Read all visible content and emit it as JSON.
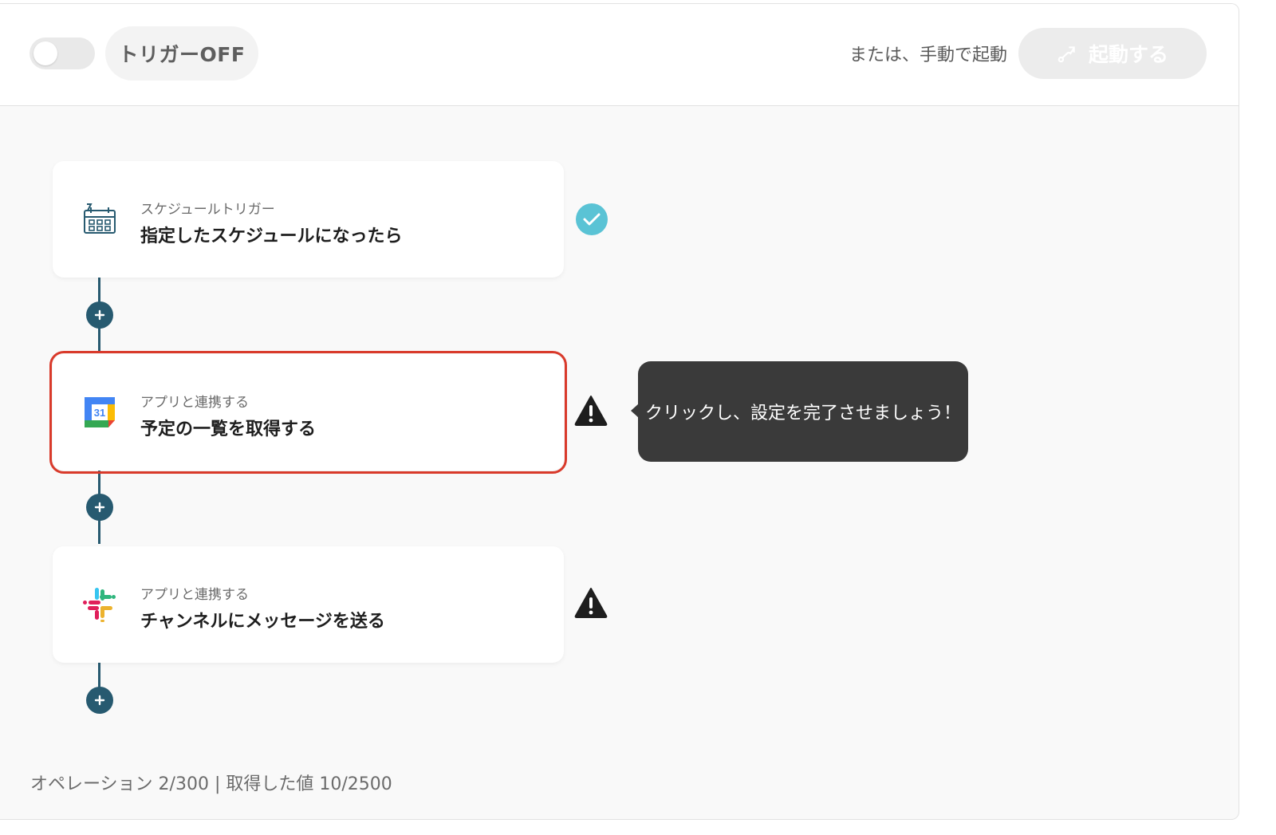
{
  "header": {
    "trigger_label": "トリガーOFF",
    "manual_label": "または、手動で起動",
    "start_button_label": "起動する"
  },
  "steps": [
    {
      "subtitle": "スケジュールトリガー",
      "title": "指定したスケジュールになったら",
      "icon": "schedule-calendar-icon",
      "status": "complete"
    },
    {
      "subtitle": "アプリと連携する",
      "title": "予定の一覧を取得する",
      "icon": "google-calendar-icon",
      "status": "warning",
      "calendar_number": "31"
    },
    {
      "subtitle": "アプリと連携する",
      "title": "チャンネルにメッセージを送る",
      "icon": "slack-icon",
      "status": "warning"
    }
  ],
  "tooltip": {
    "text": "クリックし、設定を完了させましょう！"
  },
  "footer": {
    "usage_text": "オペレーション 2/300 | 取得した値 10/2500"
  },
  "colors": {
    "accent": "#275a70",
    "highlight": "#d93a2b",
    "check": "#5ac3d5"
  }
}
